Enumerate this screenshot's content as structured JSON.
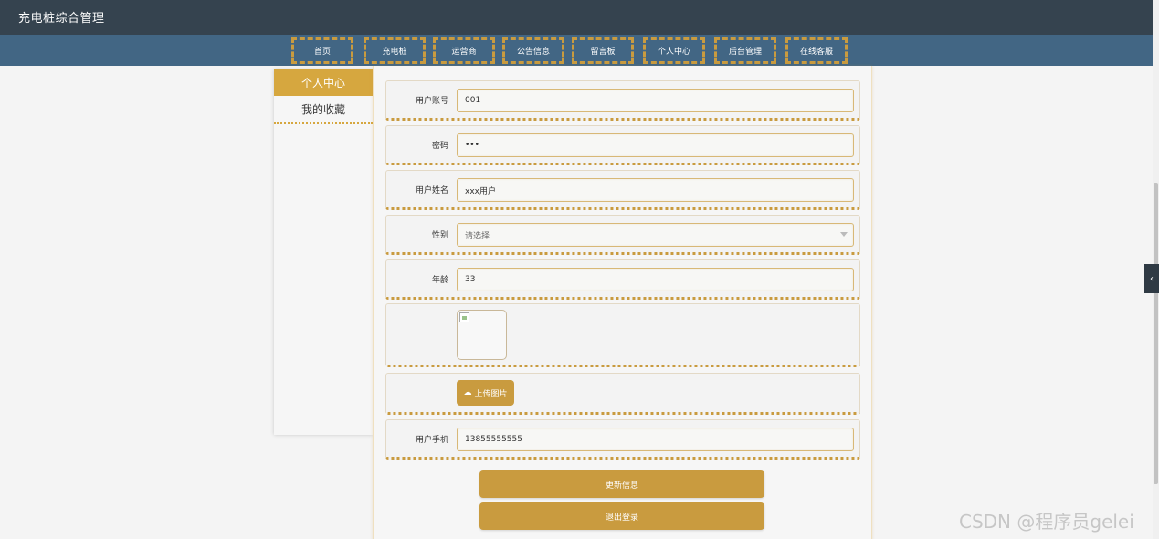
{
  "app": {
    "title": "充电桩综合管理"
  },
  "nav": {
    "items": [
      "首页",
      "充电桩",
      "运营商",
      "公告信息",
      "留言板",
      "个人中心",
      "后台管理",
      "在线客服"
    ]
  },
  "sidebar": {
    "items": [
      {
        "label": "个人中心"
      },
      {
        "label": "我的收藏"
      }
    ]
  },
  "form": {
    "account": {
      "label": "用户账号",
      "value": "001"
    },
    "password": {
      "label": "密码",
      "value": "•••"
    },
    "name": {
      "label": "用户姓名",
      "value": "xxx用户"
    },
    "gender": {
      "label": "性别",
      "placeholder": "请选择"
    },
    "age": {
      "label": "年龄",
      "value": "33"
    },
    "upload_label": "上传图片",
    "phone": {
      "label": "用户手机",
      "value": "13855555555"
    }
  },
  "actions": {
    "update": "更新信息",
    "logout": "退出登录"
  },
  "watermark": "CSDN @程序员gelei",
  "colors": {
    "header_bg": "#35434f",
    "nav_bg": "#426684",
    "accent": "#c99b3f"
  }
}
